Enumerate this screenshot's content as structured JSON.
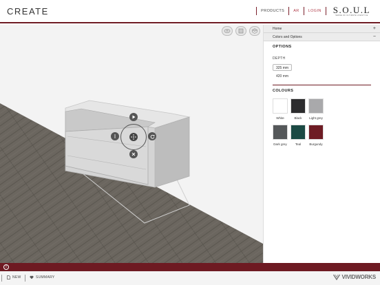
{
  "header": {
    "title": "CREATE",
    "nav": {
      "products": "PRODUCTS",
      "ar": "AR",
      "login": "LOGIN"
    },
    "brand": {
      "name": "S.O.U.L",
      "tagline": "SENSE OF ULTIMATE LIFESTYLE"
    }
  },
  "viewport": {
    "view_icons": [
      "rotate-view-icon",
      "front-view-icon",
      "top-view-icon"
    ],
    "controls": [
      "play-icon",
      "more-icon",
      "move-icon",
      "rotate-icon",
      "close-icon"
    ]
  },
  "panel": {
    "home": "Home",
    "colors_options": "Colors and Options",
    "options_title": "OPTIONS",
    "depth_label": "DEPTH",
    "depth_options": [
      "325 mm",
      "420 mm"
    ],
    "depth_selected": "325 mm",
    "colours_title": "COLOURS",
    "colours": [
      {
        "label": "White",
        "hex": "#ffffff"
      },
      {
        "label": "Black",
        "hex": "#2c2c2e"
      },
      {
        "label": "Light grey",
        "hex": "#a9a9ab"
      },
      {
        "label": "Dark grey",
        "hex": "#55585a"
      },
      {
        "label": "Teal",
        "hex": "#1b4a44"
      },
      {
        "label": "Burgundy",
        "hex": "#6e1c24"
      }
    ]
  },
  "footer": {
    "new": "NEW",
    "summary": "SUMMARY",
    "vendor": "VIVIDWORKS"
  },
  "colors": {
    "accent": "#6e1a22",
    "floor": "#6b665f"
  }
}
